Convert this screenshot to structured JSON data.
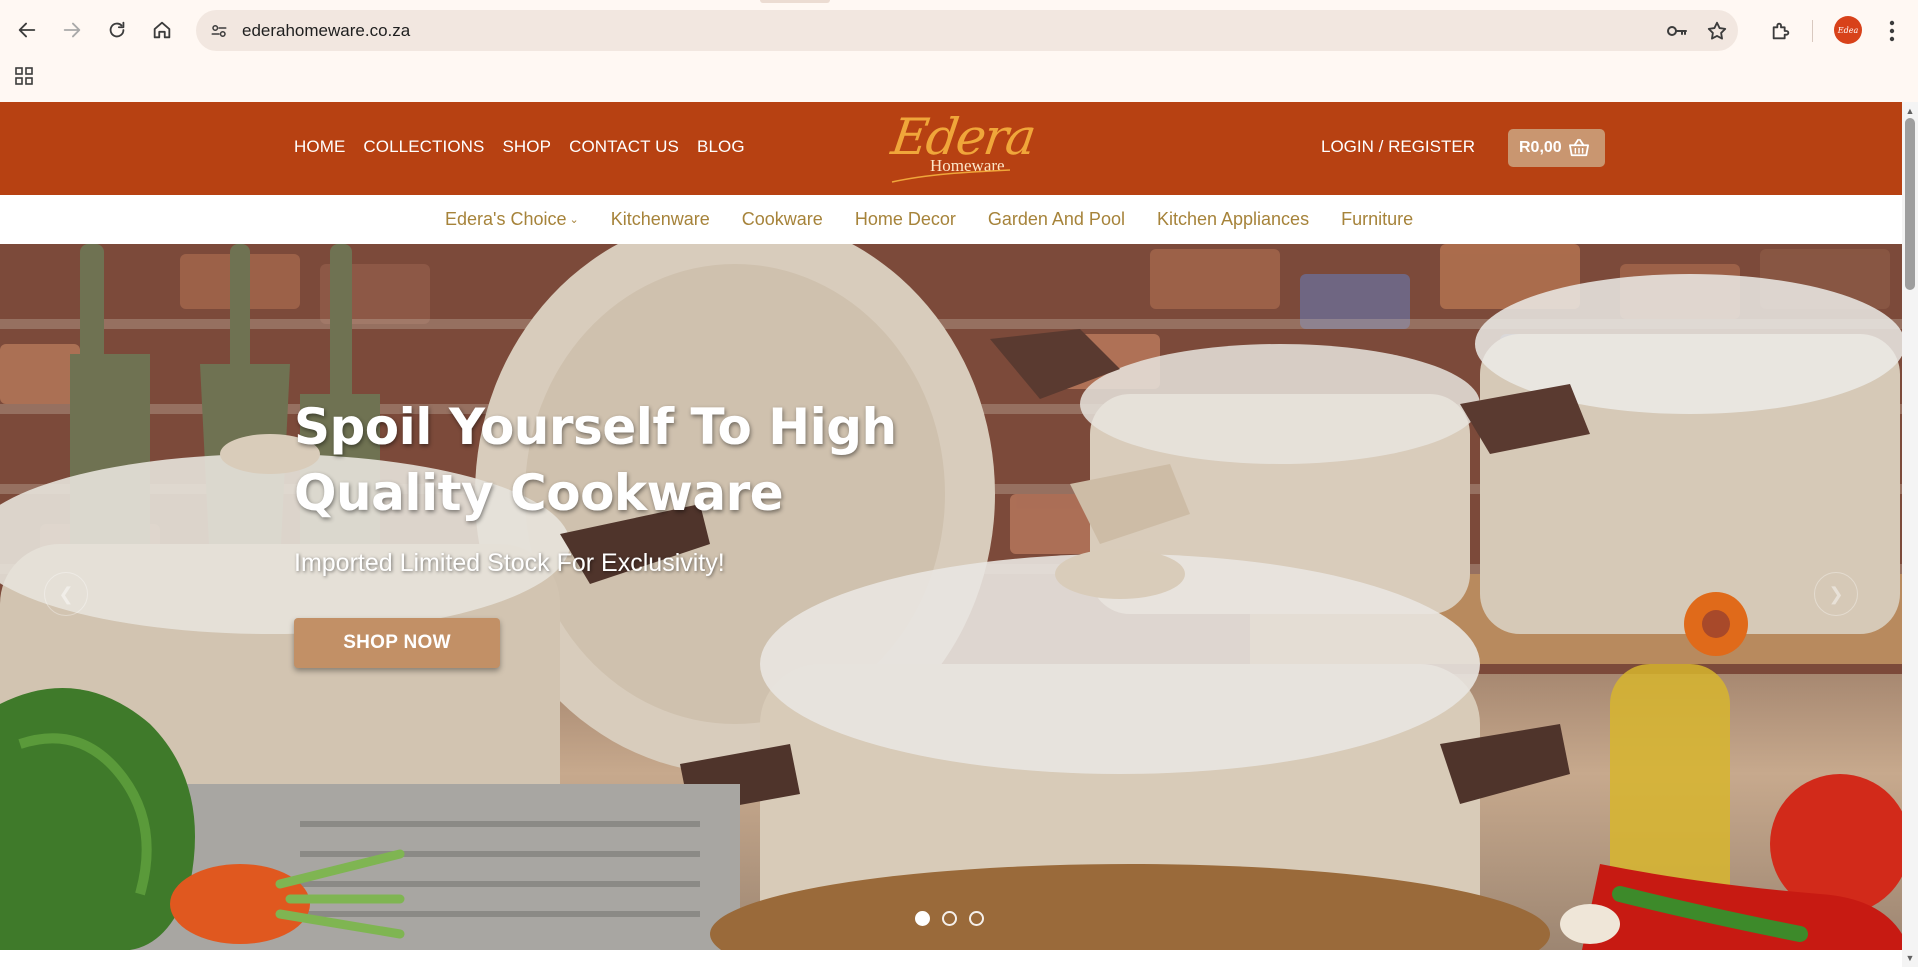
{
  "browser": {
    "url": "ederahomeware.co.za",
    "profile_initials": "Edea",
    "icons": [
      "back-arrow-icon",
      "forward-arrow-icon",
      "reload-icon",
      "home-icon",
      "site-info-icon",
      "password-key-icon",
      "bookmark-star-icon",
      "extensions-puzzle-icon",
      "kebab-menu-icon",
      "apps-grid-icon"
    ]
  },
  "header": {
    "nav": [
      "HOME",
      "COLLECTIONS",
      "SHOP",
      "CONTACT US",
      "BLOG"
    ],
    "logo_script": "Edera",
    "logo_sub": "Homeware",
    "login": "LOGIN / REGISTER",
    "cart_total": "R0,00",
    "colors": {
      "header_bg": "#b74112",
      "cart_bg": "#c99670",
      "logo_gold": "#f0a63a"
    }
  },
  "categories": [
    {
      "label": "Edera's Choice",
      "dropdown": true
    },
    {
      "label": "Kitchenware"
    },
    {
      "label": "Cookware"
    },
    {
      "label": "Home Decor"
    },
    {
      "label": "Garden And Pool"
    },
    {
      "label": "Kitchen Appliances"
    },
    {
      "label": "Furniture"
    }
  ],
  "hero": {
    "title": "Spoil Yourself To High Quality Cookware",
    "subtitle": "Imported Limited Stock For Exclusivity!",
    "cta": "SHOP NOW",
    "slide_count": 3,
    "active_slide": 1,
    "colors": {
      "cta_bg": "#c29066",
      "category_text": "#a6833a"
    }
  }
}
